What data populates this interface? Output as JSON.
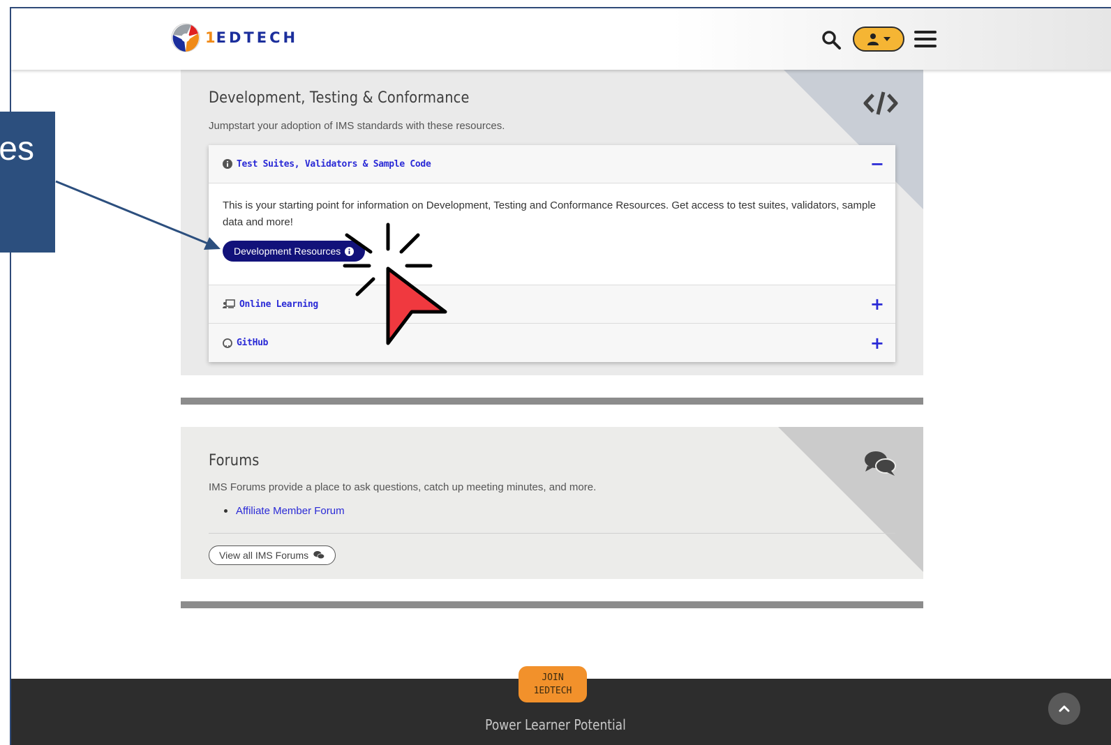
{
  "header": {
    "logo_text_one": "1",
    "logo_text_rest": "EDTECH"
  },
  "dev_card": {
    "title": "Development, Testing & Conformance",
    "subtitle": "Jumpstart your adoption of IMS standards with these resources.",
    "icon": "code-icon",
    "accordion": [
      {
        "label": "Test Suites, Validators & Sample Code",
        "icon": "info-circle-icon",
        "toggle": "−",
        "expanded": true
      },
      {
        "label": "Online Learning",
        "icon": "online-learning-icon",
        "toggle": "+",
        "expanded": false
      },
      {
        "label": "GitHub",
        "icon": "github-icon",
        "toggle": "+",
        "expanded": false
      }
    ],
    "body_text": "This is your starting point for information on Development, Testing and Conformance Resources. Get access to test suites, validators, sample data and more!",
    "dev_button": "Development Resources"
  },
  "forums_card": {
    "title": "Forums",
    "subtitle": "IMS Forums provide a place to ask questions, catch up meeting minutes, and more.",
    "links": [
      "Affiliate Member Forum"
    ],
    "view_all_button": "View all IMS Forums",
    "icon": "comments-icon"
  },
  "footer": {
    "join_line1": "JOIN",
    "join_line2": "1EDTECH",
    "tagline": "Power Learner Potential"
  },
  "callout": {
    "text": "es"
  },
  "colors": {
    "brand_blue": "#1b2e9c",
    "accent_orange": "#f2912b",
    "link_blue": "#2a2ad6",
    "callout_blue": "#2c4f7e",
    "cursor_red": "#f0393f"
  }
}
